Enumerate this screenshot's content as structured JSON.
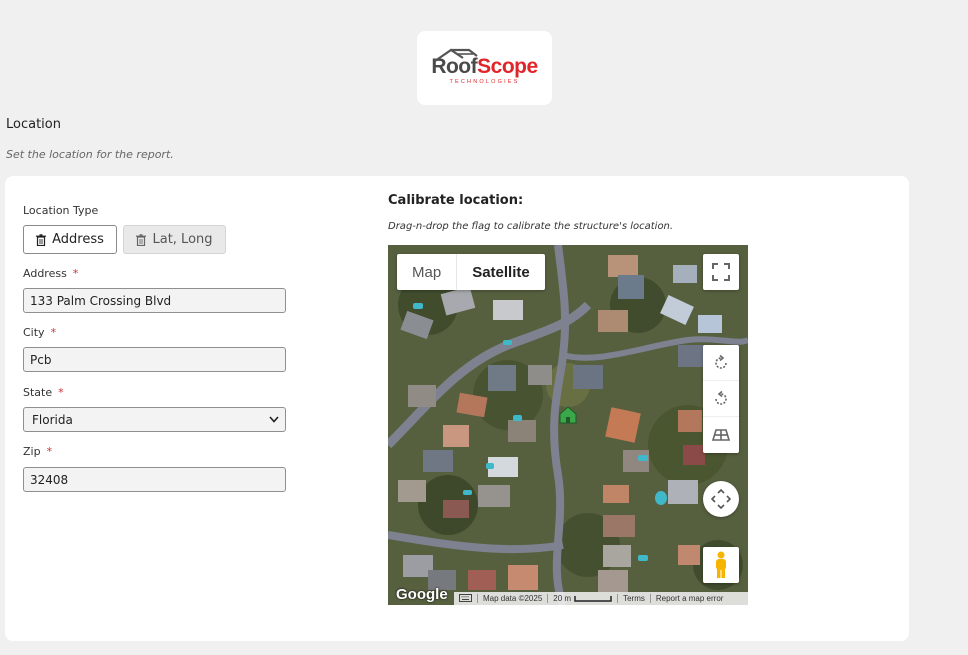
{
  "logo": {
    "brand_part1": "Roof",
    "brand_part2": "Scope",
    "tagline": "TECHNOLOGIES"
  },
  "section": {
    "title": "Location",
    "subtitle": "Set the location for the report."
  },
  "form": {
    "location_type_label": "Location Type",
    "type_buttons": {
      "address": "Address",
      "latlong": "Lat, Long"
    },
    "address_label": "Address",
    "address_value": "133 Palm Crossing Blvd",
    "city_label": "City",
    "city_value": "Pcb",
    "state_label": "State",
    "state_value": "Florida",
    "zip_label": "Zip",
    "zip_value": "32408",
    "required_mark": "*"
  },
  "calibrate": {
    "title": "Calibrate location:",
    "subtitle": "Drag-n-drop the flag to calibrate the structure's location."
  },
  "map": {
    "toggle_map": "Map",
    "toggle_satellite": "Satellite",
    "selected": "Satellite",
    "google_label": "Google",
    "footer": {
      "data": "Map data ©2025",
      "scale": "20 m",
      "terms": "Terms",
      "report": "Report a map error"
    }
  },
  "colors": {
    "required": "#d03030",
    "brand_red": "#e0262a",
    "pin": "#3aa84a"
  }
}
